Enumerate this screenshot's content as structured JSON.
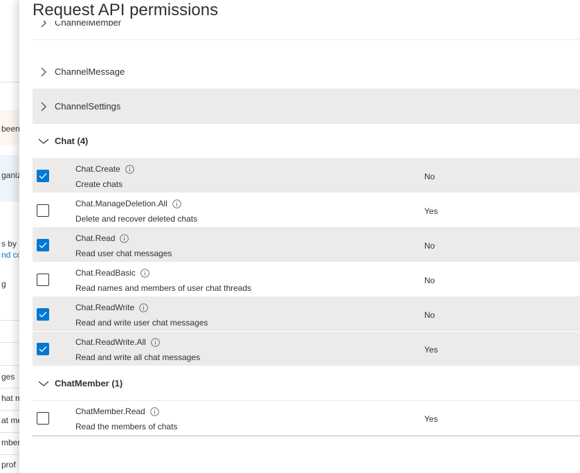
{
  "background": {
    "snippets": [
      {
        "text": "been",
        "link": false
      },
      {
        "text": "ganiza",
        "link": false
      },
      {
        "text": "s by u",
        "link": false
      },
      {
        "text": "nd co",
        "link": true
      },
      {
        "text": "g",
        "link": false
      },
      {
        "text": "ges",
        "link": false
      },
      {
        "text": "hat m",
        "link": false
      },
      {
        "text": "at me",
        "link": false
      },
      {
        "text": "mbers",
        "link": false
      },
      {
        "text": "prof",
        "link": false
      }
    ]
  },
  "panel": {
    "title": "Request API permissions"
  },
  "groups": [
    {
      "label": "ChannelMember",
      "expanded": false,
      "partial": true
    },
    {
      "label": "ChannelMessage",
      "expanded": false
    },
    {
      "label": "ChannelSettings",
      "expanded": false
    },
    {
      "label": "Chat (4)",
      "expanded": true
    },
    {
      "label": "ChatMember (1)",
      "expanded": true
    }
  ],
  "permissions": [
    {
      "name": "Chat.Create",
      "description": "Create chats",
      "admin_consent": "No",
      "checked": true
    },
    {
      "name": "Chat.ManageDeletion.All",
      "description": "Delete and recover deleted chats",
      "admin_consent": "Yes",
      "checked": false
    },
    {
      "name": "Chat.Read",
      "description": "Read user chat messages",
      "admin_consent": "No",
      "checked": true
    },
    {
      "name": "Chat.ReadBasic",
      "description": "Read names and members of user chat threads",
      "admin_consent": "No",
      "checked": false
    },
    {
      "name": "Chat.ReadWrite",
      "description": "Read and write user chat messages",
      "admin_consent": "No",
      "checked": true
    },
    {
      "name": "Chat.ReadWrite.All",
      "description": "Read and write all chat messages",
      "admin_consent": "Yes",
      "checked": true
    },
    {
      "name": "ChatMember.Read",
      "description": "Read the members of chats",
      "admin_consent": "Yes",
      "checked": false
    }
  ],
  "colors": {
    "accent": "#0078d4",
    "row_selected": "#edebe9",
    "text": "#323130"
  }
}
